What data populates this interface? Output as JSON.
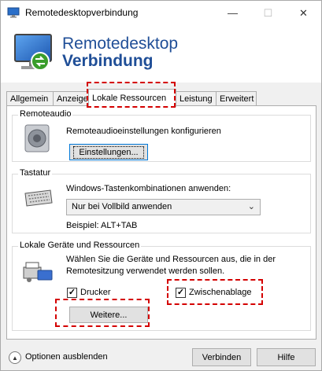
{
  "window": {
    "title": "Remotedesktopverbindung",
    "minimize_glyph": "—",
    "maximize_glyph": "☐",
    "close_glyph": "✕"
  },
  "banner": {
    "line1": "Remotedesktop",
    "line2": "Verbindung"
  },
  "tabs": [
    "Allgemein",
    "Anzeige",
    "Lokale Ressourcen",
    "Leistung",
    "Erweitert"
  ],
  "active_tab": "Lokale Ressourcen",
  "remoteaudio": {
    "title": "Remoteaudio",
    "description": "Remoteaudioeinstellungen konfigurieren",
    "button": "Einstellungen..."
  },
  "tastatur": {
    "title": "Tastatur",
    "description": "Windows-Tastenkombinationen anwenden:",
    "selected": "Nur bei Vollbild anwenden",
    "example": "Beispiel: ALT+TAB"
  },
  "lokale_geraete": {
    "title": "Lokale Geräte und Ressourcen",
    "description_line1": "Wählen Sie die Geräte und Ressourcen aus, die in der",
    "description_line2": "Remotesitzung verwendet werden sollen.",
    "drucker_label": "Drucker",
    "drucker_checked": true,
    "zwischenablage_label": "Zwischenablage",
    "zwischenablage_checked": true,
    "more_button": "Weitere..."
  },
  "footer": {
    "options_toggle": "Optionen ausblenden",
    "connect_button": "Verbinden",
    "help_button": "Hilfe"
  },
  "colors": {
    "highlight": "#d40000",
    "banner_text": "#1f4e97",
    "focus_border": "#0078d7"
  }
}
